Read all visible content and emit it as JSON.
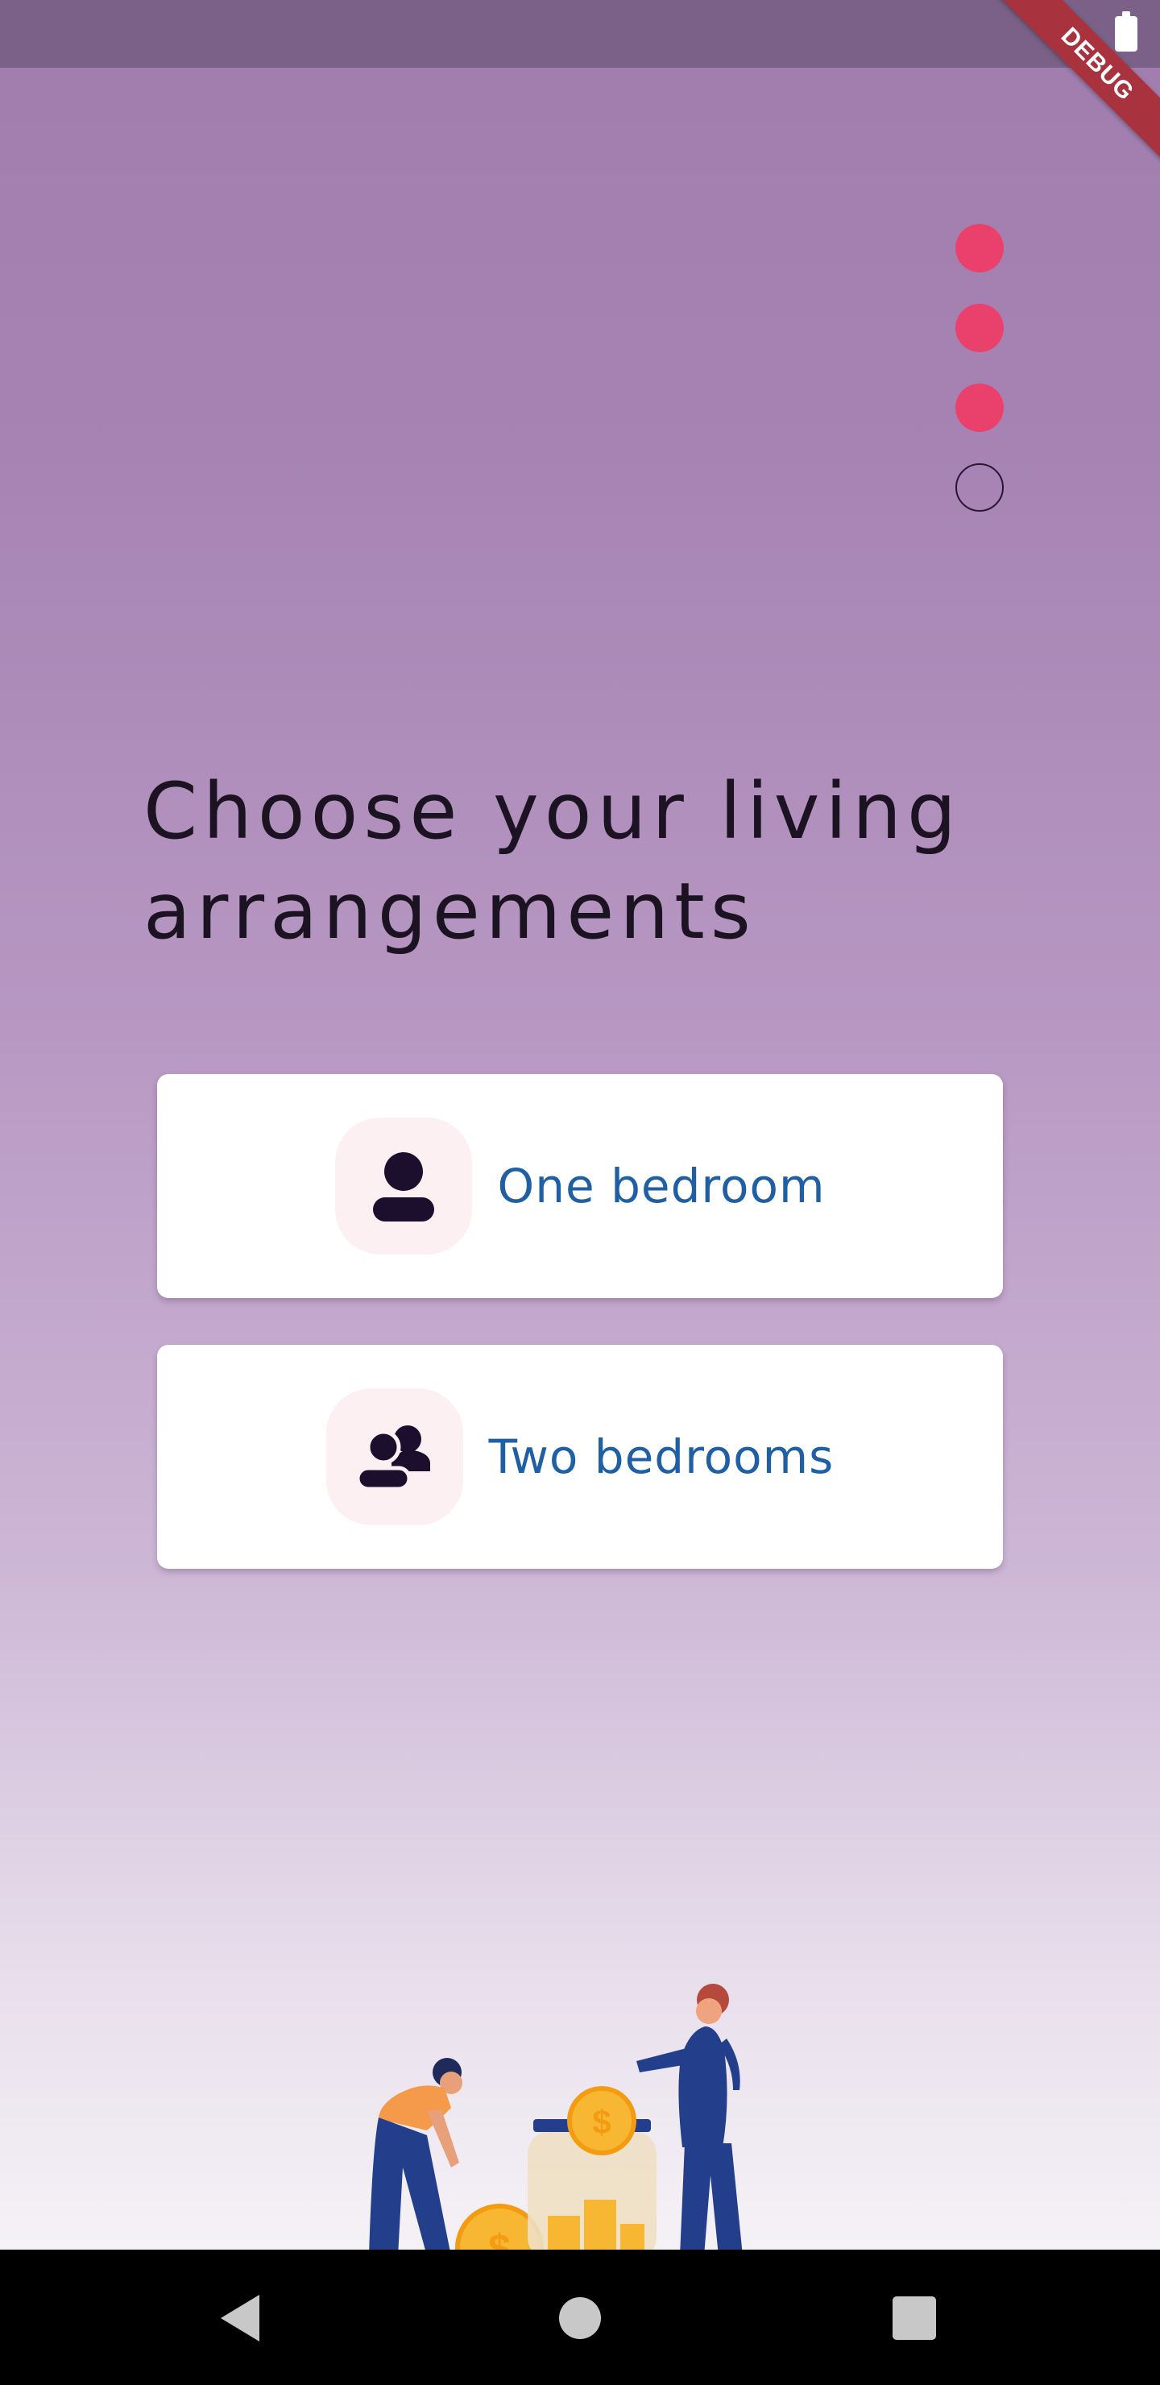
{
  "debug_banner": "DEBUG",
  "progress": {
    "total_steps": 4,
    "completed_steps": 3
  },
  "title": "Choose your living arrangements",
  "options": [
    {
      "label": "One bedroom",
      "icon": "person-icon"
    },
    {
      "label": "Two bedrooms",
      "icon": "people-icon"
    }
  ],
  "illustration": "people-saving-coins-illustration",
  "colors": {
    "accent_dot": "#e9416b",
    "option_text": "#1f5fa3",
    "icon_bubble": "#fdf0f2",
    "title_text": "#1c1322"
  },
  "nav": {
    "back": "back-icon",
    "home": "home-icon",
    "recents": "recents-icon"
  }
}
